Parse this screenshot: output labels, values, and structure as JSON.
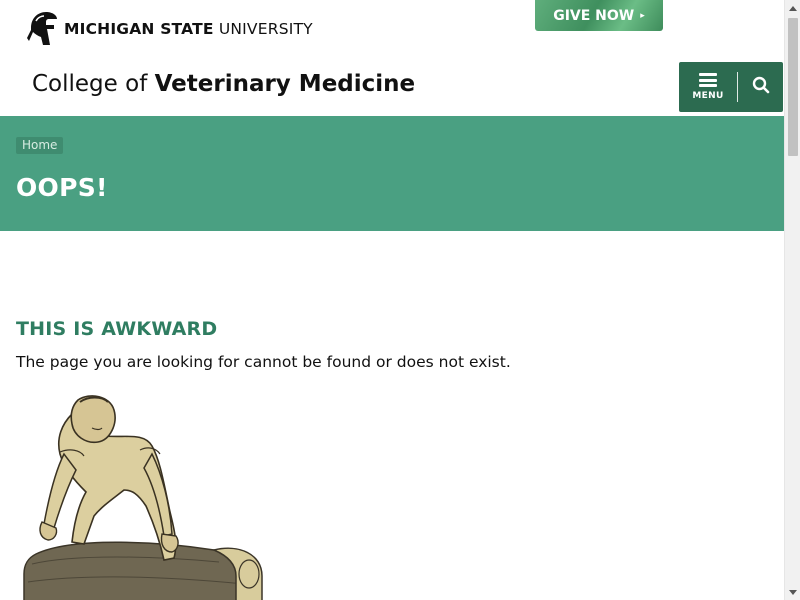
{
  "header": {
    "university_bold": "MICHIGAN STATE",
    "university_regular": " UNIVERSITY",
    "give_now": "GIVE NOW",
    "give_now_arrow": "▸",
    "college_prefix": "College of ",
    "college_name": "Veterinary Medicine",
    "menu_label": "MENU"
  },
  "banner": {
    "breadcrumb": "Home",
    "title": "OOPS!"
  },
  "main": {
    "heading": "THIS IS AWKWARD",
    "message": "The page you are looking for cannot be found or does not exist."
  },
  "icons": {
    "logo": "spartan-helmet-icon",
    "menu": "hamburger-icon",
    "search": "search-icon",
    "scroll_up": "chevron-up-icon",
    "scroll_down": "chevron-down-icon"
  },
  "colors": {
    "brand_green": "#2c6b50",
    "banner_green": "#4aa082",
    "heading_green": "#2f7d61"
  }
}
